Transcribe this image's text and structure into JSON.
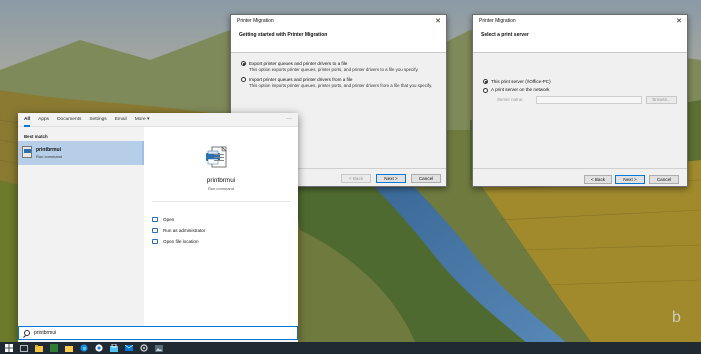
{
  "dialog_export": {
    "title": "Printer Migration",
    "heading": "Getting started with Printer Migration",
    "option_export": "Export printer queues and printer drivers to a file",
    "option_export_desc": "This option exports printer queues, printer ports, and printer drivers to a file you specify.",
    "option_import": "Import printer queues and printer drivers from a file",
    "option_import_desc": "This option imports printer queues, printer ports, and printer drivers from a file that you specify.",
    "back_label": "< Back",
    "next_label": "Next >",
    "cancel_label": "Cancel"
  },
  "dialog_server": {
    "title": "Printer Migration",
    "heading": "Select a print server",
    "option_this": "This print server (\\\\Office-PC)",
    "option_network": "A print server on the network",
    "server_name_label": "Server name:",
    "browse_label": "Browse...",
    "back_label": "< Back",
    "next_label": "Next >",
    "cancel_label": "Cancel"
  },
  "start_menu": {
    "tabs": [
      "All",
      "Apps",
      "Documents",
      "Settings",
      "Email",
      "More ▾"
    ],
    "dots": "···",
    "best_match": "Best match",
    "result_name": "printbrmui",
    "result_type": "Run command",
    "detail_name": "printbrmui",
    "detail_type": "Run command",
    "actions": [
      "Open",
      "Run as administrator",
      "Open file location"
    ]
  },
  "search": {
    "value": "printbrmui"
  },
  "taskbar": {
    "icons": [
      "windows-icon",
      "search-icon",
      "task-view-icon",
      "file-explorer-icon",
      "folder-icon",
      "edge-icon",
      "store-icon",
      "mail-icon",
      "settings-icon",
      "photos-icon",
      "app-icon"
    ]
  },
  "colors": {
    "accent": "#0078d7",
    "selection": "#b7cee8"
  }
}
